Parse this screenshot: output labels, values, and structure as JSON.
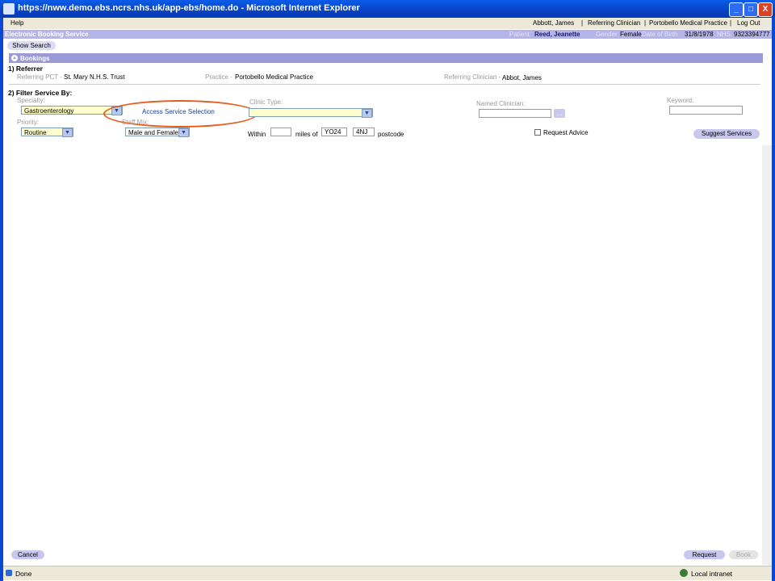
{
  "window": {
    "title": "https://nww.demo.ebs.ncrs.nhs.uk/app-ebs/home.do - Microsoft Internet Explorer",
    "buttons": {
      "minimize": "_",
      "maximize": "□",
      "close": "X"
    }
  },
  "menubar": {
    "help": "Help",
    "user": "Abbott, James",
    "role": "Referring Clinician",
    "org": "Portobello Medical Practice",
    "logout": "Log Out",
    "sep": "|"
  },
  "header": {
    "app_title": "Electronic Booking Service",
    "patient_label": "Patient:",
    "patient_name": "Reed, Jeanette",
    "gender_label": "Gender",
    "gender": "Female",
    "dob_label": "Date of Birth",
    "dob": "31/8/1978",
    "nhs_label": "NHS",
    "nhs": "9323394777"
  },
  "show_search": "Show Search",
  "bookings": {
    "title": "Bookings",
    "collapse_glyph": "▲"
  },
  "referrer": {
    "heading": "1) Referrer",
    "pct_label": "Referring PCT -",
    "pct": "St. Mary N.H.S. Trust",
    "practice_label": "Practice -",
    "practice": "Portobello Medical Practice",
    "clinician_label": "Referring Clinician -",
    "clinician": "Abbot, James"
  },
  "filter": {
    "heading": "2) Filter Service By:",
    "specialty_label": "Specialty:",
    "specialty": "Gastroenterology",
    "access_link": "Access Service Selection",
    "clinic_type_label": "Clinic Type:",
    "clinic_type": "",
    "named_clinician_label": "Named Clinician:",
    "named_clinician_btn": "...",
    "keyword_label": "Keyword:",
    "priority_label": "Priority:",
    "priority": "Routine",
    "staff_mix_label": "Staff Mix:",
    "staff_mix": "Male and Female",
    "within_label": "Within",
    "miles_of_label": "miles of",
    "postcode1": "YO24",
    "postcode2": "4NJ",
    "postcode_label": "postcode",
    "request_advice_label": "Request Advice",
    "request_advice_checked": false,
    "suggest_button": "Suggest Services",
    "dropdown_glyph": "▼"
  },
  "footer": {
    "cancel": "Cancel",
    "request": "Request",
    "book": "Book"
  },
  "status": {
    "left": "Done",
    "zone": "Local intranet"
  }
}
